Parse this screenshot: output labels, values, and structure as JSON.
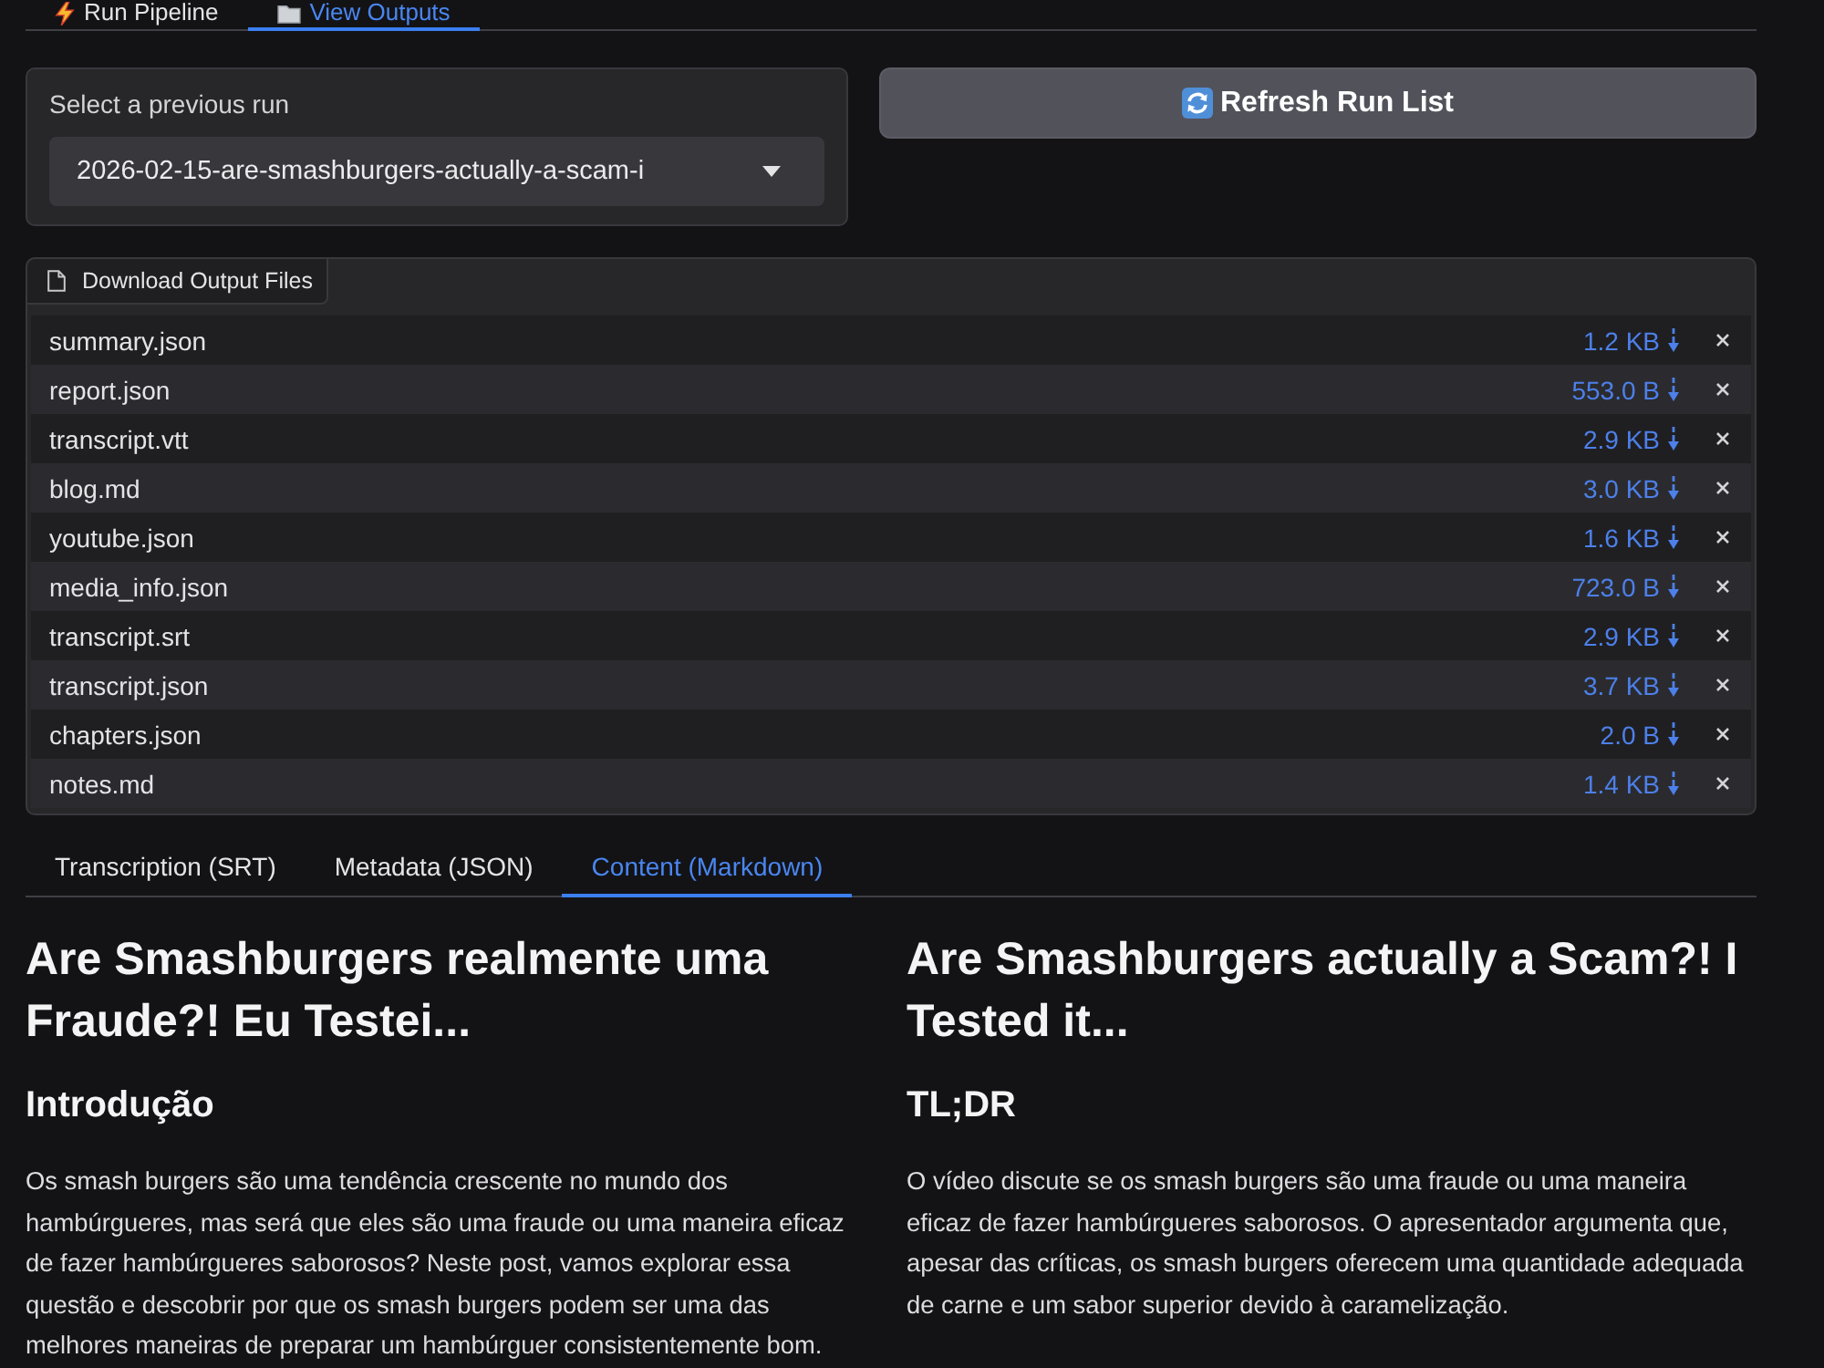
{
  "top_tabs": [
    {
      "label": "Run Pipeline",
      "selected": false
    },
    {
      "label": "View Outputs",
      "selected": true
    }
  ],
  "run_select": {
    "label": "Select a previous run",
    "value": "2026-02-15-are-smashburgers-actually-a-scam-i"
  },
  "refresh_button": {
    "label": "Refresh Run List"
  },
  "output_files": {
    "label": "Download Output Files",
    "files": [
      {
        "name": "summary.json",
        "size": "1.2 KB"
      },
      {
        "name": "report.json",
        "size": "553.0 B"
      },
      {
        "name": "transcript.vtt",
        "size": "2.9 KB"
      },
      {
        "name": "blog.md",
        "size": "3.0 KB"
      },
      {
        "name": "youtube.json",
        "size": "1.6 KB"
      },
      {
        "name": "media_info.json",
        "size": "723.0 B"
      },
      {
        "name": "transcript.srt",
        "size": "2.9 KB"
      },
      {
        "name": "transcript.json",
        "size": "3.7 KB"
      },
      {
        "name": "chapters.json",
        "size": "2.0 B"
      },
      {
        "name": "notes.md",
        "size": "1.4 KB"
      }
    ]
  },
  "content_tabs": [
    {
      "label": "Transcription (SRT)",
      "selected": false
    },
    {
      "label": "Metadata (JSON)",
      "selected": false
    },
    {
      "label": "Content (Markdown)",
      "selected": true
    }
  ],
  "content": {
    "columns": [
      {
        "title": "Are Smashburgers realmente uma Fraude?! Eu Testei...",
        "sections": [
          {
            "heading": "Introdução",
            "paragraphs": [
              "Os smash burgers são uma tendência crescente no mundo dos hambúrgueres, mas será que eles são uma fraude ou uma maneira eficaz de fazer hambúrgueres saborosos? Neste post, vamos explorar essa questão e descobrir por que os smash burgers podem ser uma das melhores maneiras de preparar um hambúrguer consistentemente bom."
            ]
          }
        ]
      },
      {
        "title": "Are Smashburgers actually a Scam?! I Tested it...",
        "sections": [
          {
            "heading": "TL;DR",
            "paragraphs": [
              "O vídeo discute se os smash burgers são uma fraude ou uma maneira eficaz de fazer hambúrgueres saborosos. O apresentador argumenta que, apesar das críticas, os smash burgers oferecem uma quantidade adequada de carne e um sabor superior devido à caramelização."
            ]
          }
        ]
      }
    ]
  }
}
